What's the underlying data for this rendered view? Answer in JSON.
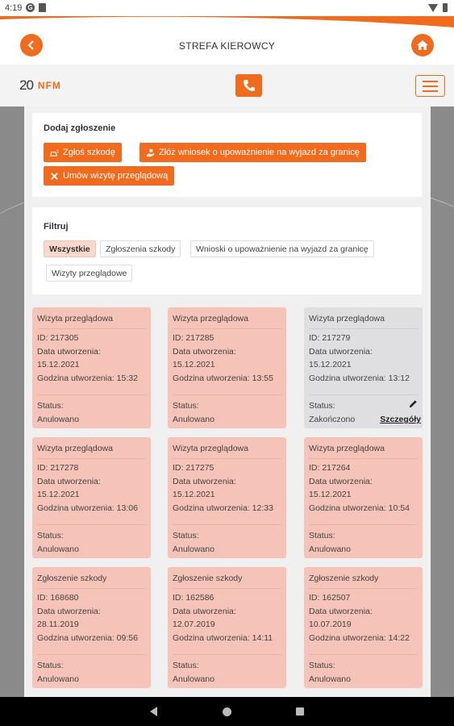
{
  "status_bar": {
    "time": "4:19",
    "g_glyph": "G"
  },
  "header": {
    "title": "STREFA KIEROWCY"
  },
  "logo": {
    "number": "20",
    "brand": "NFM"
  },
  "add_panel": {
    "title": "Dodaj zgłoszenie",
    "buttons": [
      {
        "label": "Zgłoś szkodę",
        "icon": "car-crash-icon"
      },
      {
        "label": "Złóż wniosek o upoważnienie na wyjazd za granicę",
        "icon": "hand-document-icon"
      },
      {
        "label": "Umów wizytę przeglądową",
        "icon": "tools-icon"
      }
    ]
  },
  "filter_panel": {
    "title": "Filtruj",
    "chips": [
      {
        "label": "Wszystkie",
        "active": true
      },
      {
        "label": "Zgłoszenia szkody",
        "active": false
      },
      {
        "label": "Wnioski o upoważnienie na wyjazd za granicę",
        "active": false
      },
      {
        "label": "Wizyty przeglądowe",
        "active": false
      }
    ]
  },
  "cards_labels": {
    "date_label": "Data utworzenia:",
    "status_label": "Status:",
    "details_label": "Szczegóły"
  },
  "cards": [
    {
      "type": "Wizyta przeglądowa",
      "id": "ID: 217305",
      "date": "15.12.2021",
      "time": "Godzina utworzenia: 15:32",
      "status": "Anulowano"
    },
    {
      "type": "Wizyta przeglądowa",
      "id": "ID: 217285",
      "date": "15.12.2021",
      "time": "Godzina utworzenia: 13:55",
      "status": "Anulowano"
    },
    {
      "type": "Wizyta przeglądowa",
      "id": "ID: 217279",
      "date": "15.12.2021",
      "time": "Godzina utworzenia: 13:12",
      "status": "Zakończono"
    },
    {
      "type": "Wizyta przeglądowa",
      "id": "ID: 217278",
      "date": "15.12.2021",
      "time": "Godzina utworzenia: 13:06",
      "status": "Anulowano"
    },
    {
      "type": "Wizyta przeglądowa",
      "id": "ID: 217275",
      "date": "15.12.2021",
      "time": "Godzina utworzenia: 12:33",
      "status": "Anulowano"
    },
    {
      "type": "Wizyta przeglądowa",
      "id": "ID: 217264",
      "date": "15.12.2021",
      "time": "Godzina utworzenia: 10:54",
      "status": "Anulowano"
    },
    {
      "type": "Zgłoszenie szkody",
      "id": "ID: 168680",
      "date": "28.11.2019",
      "time": "Godzina utworzenia: 09:56",
      "status": "Anulowano"
    },
    {
      "type": "Zgłoszenie szkody",
      "id": "ID: 162586",
      "date": "12.07.2019",
      "time": "Godzina utworzenia: 14:11",
      "status": "Anulowano"
    },
    {
      "type": "Zgłoszenie szkody",
      "id": "ID: 162507",
      "date": "10.07.2019",
      "time": "Godzina utworzenia: 14:22",
      "status": "Anulowano"
    }
  ],
  "colors": {
    "accent": "#f26b1d",
    "card_cancelled": "#f5c3b7",
    "card_done": "#dfdfe1"
  }
}
